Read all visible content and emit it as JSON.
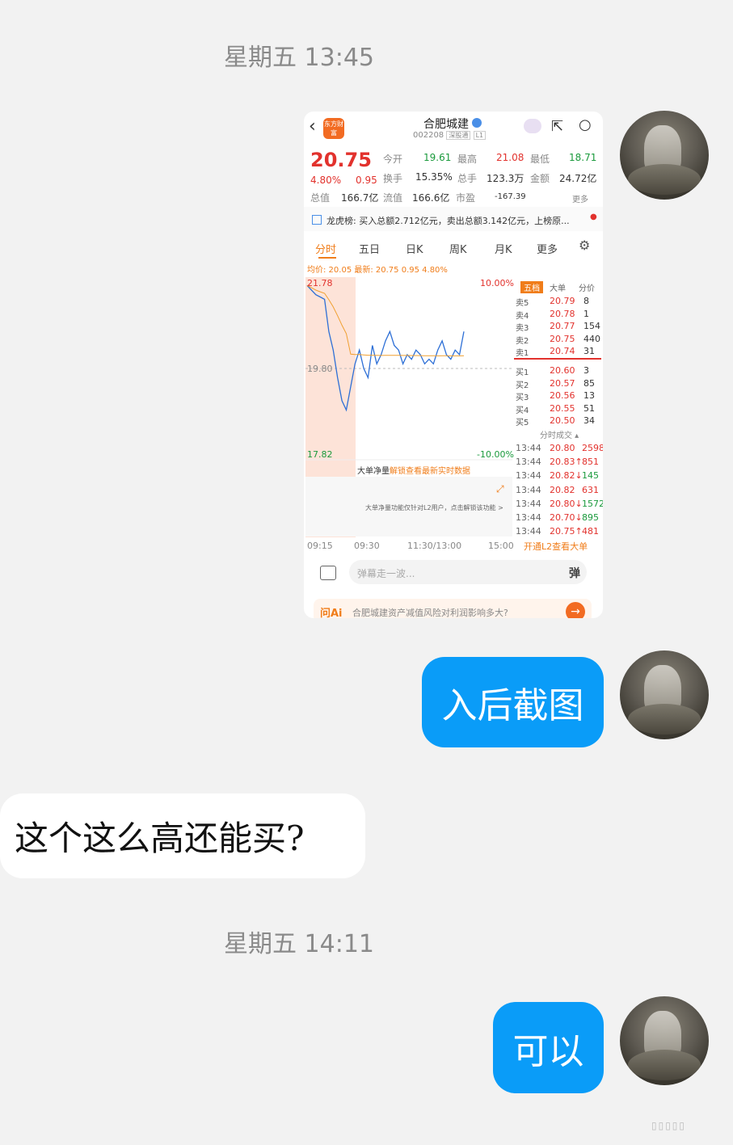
{
  "chat": {
    "timestamp1": "星期五 13:45",
    "timestamp2": "星期五 14:11",
    "msg_me_1": "入后截图",
    "msg_them_1": "这个这么高还能买?",
    "msg_me_2": "可以"
  },
  "colors": {
    "bubble_me": "#0a9cf8",
    "bubble_them": "#ffffff",
    "background": "#f2f2f2",
    "up": "#e2322d",
    "down": "#1a9a3c",
    "accent": "#f07d1a"
  },
  "stock": {
    "logo": "东方财富",
    "name": "合肥城建",
    "code": "002208",
    "tag1": "深股通",
    "tag2": "L1",
    "price": "20.75",
    "pct": "4.80%",
    "chg": "0.95",
    "row1": {
      "open_label": "今开",
      "open": "19.61",
      "high_label": "最高",
      "high": "21.08",
      "low_label": "最低",
      "low": "18.71"
    },
    "row2": {
      "turnover_label": "换手",
      "turnover": "15.35%",
      "volume_label": "总手",
      "volume": "123.3万",
      "amount_label": "金额",
      "amount": "24.72亿"
    },
    "row3": {
      "mcap_label": "总值",
      "mcap": "166.7亿",
      "float_label": "流值",
      "float": "166.6亿",
      "pe_label": "市盈",
      "pe": "-167.39",
      "more": "更多"
    },
    "longhu": "龙虎榜: 买入总额2.712亿元，卖出总额3.142亿元，上榜原...",
    "tabs": [
      "分时",
      "五日",
      "日K",
      "周K",
      "月K",
      "更多"
    ],
    "avg_line": "均价: 20.05 最新: 20.75 0.95 4.80%",
    "chart_top": "21.78",
    "chart_mid": "19.80",
    "chart_bottom": "17.82",
    "pct_top": "10.00%",
    "pct_bottom": "-10.00%",
    "flow_title": "大单净量",
    "flow_unlock": "解锁查看最新实时数据",
    "flow_note": "大单净量功能仅针对L2用户，点击解锁该功能 >",
    "times": [
      "09:15",
      "09:30",
      "11:30/13:00",
      "15:00"
    ],
    "ob_header": [
      "五档",
      "大单",
      "分价"
    ],
    "asks": [
      {
        "label": "卖5",
        "price": "20.79",
        "vol": "8"
      },
      {
        "label": "卖4",
        "price": "20.78",
        "vol": "1"
      },
      {
        "label": "卖3",
        "price": "20.77",
        "vol": "154"
      },
      {
        "label": "卖2",
        "price": "20.75",
        "vol": "440"
      },
      {
        "label": "卖1",
        "price": "20.74",
        "vol": "31"
      }
    ],
    "bids": [
      {
        "label": "买1",
        "price": "20.60",
        "vol": "3"
      },
      {
        "label": "买2",
        "price": "20.57",
        "vol": "85"
      },
      {
        "label": "买3",
        "price": "20.56",
        "vol": "13"
      },
      {
        "label": "买4",
        "price": "20.55",
        "vol": "51"
      },
      {
        "label": "买5",
        "price": "20.50",
        "vol": "34"
      }
    ],
    "ticks_title": "分时成交",
    "ticks": [
      {
        "t": "13:44",
        "p": "20.80",
        "v": "2598",
        "c": "red"
      },
      {
        "t": "13:44",
        "p": "20.83↑",
        "v": "851",
        "c": "red"
      },
      {
        "t": "13:44",
        "p": "20.82↓",
        "v": "145",
        "c": "green"
      },
      {
        "t": "13:44",
        "p": "20.82",
        "v": "631",
        "c": "red"
      },
      {
        "t": "13:44",
        "p": "20.80↓",
        "v": "1572",
        "c": "green"
      },
      {
        "t": "13:44",
        "p": "20.70↓",
        "v": "895",
        "c": "green"
      },
      {
        "t": "13:44",
        "p": "20.75↑",
        "v": "481",
        "c": "red"
      }
    ],
    "l2_link": "开通L2查看大单",
    "danmu_placeholder": "弹幕走一波...",
    "danmu_btn": "弹",
    "ai_label": "问Ai",
    "ai_question": "合肥城建资产减值风险对利润影响多大?",
    "price_series": [
      21.6,
      21.5,
      21.4,
      21.35,
      21.3,
      20.6,
      20.2,
      19.6,
      19.1,
      18.9,
      19.4,
      19.9,
      20.2,
      19.8,
      19.6,
      20.3,
      19.9,
      20.1,
      20.4,
      20.6,
      20.3,
      20.2,
      19.9,
      20.1,
      20.0,
      20.2,
      20.1,
      19.9,
      20.0,
      19.9,
      20.2,
      20.4,
      20.1,
      20.0,
      20.2,
      20.1,
      20.6
    ]
  }
}
